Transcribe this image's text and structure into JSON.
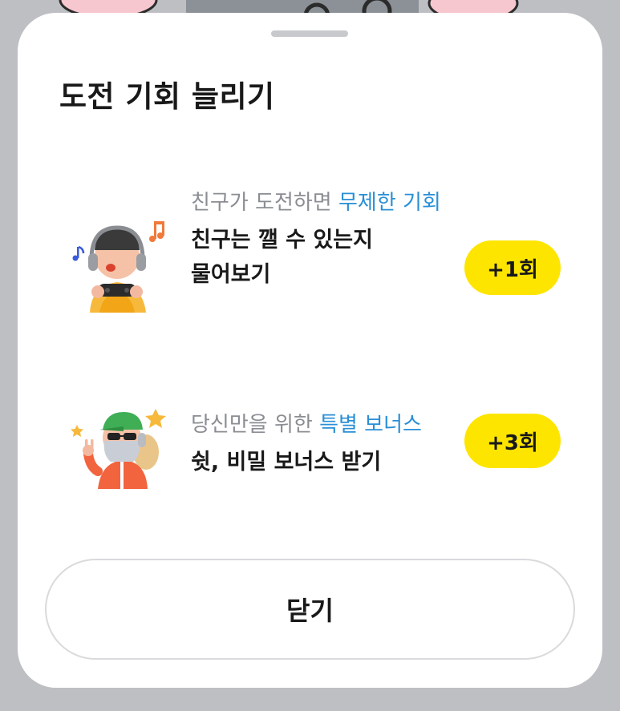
{
  "sheet": {
    "title": "도전 기회 늘리기",
    "close_label": "닫기"
  },
  "rewards": [
    {
      "illustration": "gamer-with-headphones-illustration",
      "sub_plain": "친구가 도전하면 ",
      "sub_highlight": "무제한 기회",
      "main_text_line1": "친구는 깰 수 있는지",
      "main_text_line2": "물어보기",
      "badge": "+1회"
    },
    {
      "illustration": "sunglasses-rocker-illustration",
      "sub_plain": "당신만을 위한 ",
      "sub_highlight": "특별 보너스",
      "main_text_line1": "쉿, 비밀 보너스 받기",
      "badge": "+3회"
    }
  ],
  "colors": {
    "accent_yellow": "#fee500",
    "highlight_blue": "#2a8fd6",
    "subtext_gray": "#8a8d92",
    "text_dark": "#191919",
    "backdrop": "#bdbfc3"
  }
}
